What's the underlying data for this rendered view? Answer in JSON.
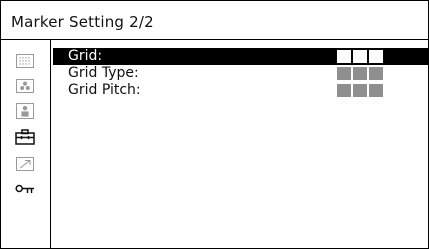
{
  "header": {
    "title": "Marker Setting 2/2"
  },
  "sidebar": {
    "items": [
      {
        "icon": "grid-dots-icon",
        "interactable": true
      },
      {
        "icon": "color-dots-icon",
        "interactable": true
      },
      {
        "icon": "person-icon",
        "interactable": true
      },
      {
        "icon": "toolbox-icon",
        "interactable": true,
        "active": true
      },
      {
        "icon": "arrow-icon",
        "interactable": true
      },
      {
        "icon": "key-icon",
        "interactable": true
      }
    ]
  },
  "menu": {
    "rows": [
      {
        "label": "Grid:",
        "selected": true,
        "value_icon": "three-blocks-icon",
        "value_color": "#ffffff"
      },
      {
        "label": "Grid Type:",
        "selected": false,
        "value_icon": "three-blocks-icon",
        "value_color": "#8f8f8f"
      },
      {
        "label": "Grid Pitch:",
        "selected": false,
        "value_icon": "three-blocks-icon",
        "value_color": "#8f8f8f"
      }
    ]
  },
  "colors": {
    "highlight": "#000000",
    "text": "#111111",
    "value_block_inactive": "#8f8f8f",
    "value_block_active": "#ffffff"
  }
}
